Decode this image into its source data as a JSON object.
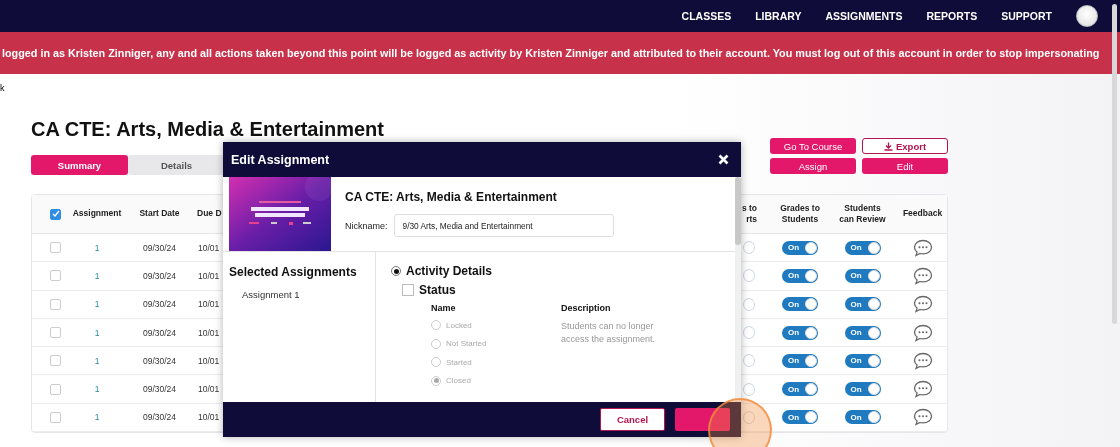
{
  "nav": {
    "items": [
      {
        "label": "CLASSES"
      },
      {
        "label": "LIBRARY"
      },
      {
        "label": "ASSIGNMENTS"
      },
      {
        "label": "REPORTS"
      },
      {
        "label": "SUPPORT"
      }
    ]
  },
  "banner": {
    "text": "logged in as Kristen Zinniger, any and all actions taken beyond this point will be logged as activity by Kristen Zinniger and attributed to their account. You must log out of this account in order to stop impersonating"
  },
  "stray_text": "k",
  "course": {
    "title": "CA CTE: Arts, Media & Entertainment"
  },
  "tabs": [
    {
      "label": "Summary",
      "selected": true
    },
    {
      "label": "Details",
      "selected": false
    }
  ],
  "actions": [
    {
      "label": "Go To Course",
      "kind": "filled"
    },
    {
      "label": "Export",
      "kind": "outline"
    },
    {
      "label": "Assign",
      "kind": "filled"
    },
    {
      "label": "Edit",
      "kind": "filled"
    }
  ],
  "table": {
    "select_all_checked": true,
    "columns": [
      "Assignment",
      "Start Date",
      "Due D",
      "s to\nrts",
      "Grades to\nStudents",
      "Students\ncan Review",
      "Feedback"
    ],
    "rows": [
      {
        "checked": false,
        "assignment": "1",
        "start_date": "09/30/24",
        "due_date": "10/01",
        "grades_to_students": {
          "on": true,
          "label": "On"
        },
        "students_can_review": {
          "on": true,
          "label": "On"
        }
      },
      {
        "checked": false,
        "assignment": "1",
        "start_date": "09/30/24",
        "due_date": "10/01",
        "grades_to_students": {
          "on": true,
          "label": "On"
        },
        "students_can_review": {
          "on": true,
          "label": "On"
        }
      },
      {
        "checked": false,
        "assignment": "1",
        "start_date": "09/30/24",
        "due_date": "10/01",
        "grades_to_students": {
          "on": true,
          "label": "On"
        },
        "students_can_review": {
          "on": true,
          "label": "On"
        }
      },
      {
        "checked": false,
        "assignment": "1",
        "start_date": "09/30/24",
        "due_date": "10/01",
        "grades_to_students": {
          "on": true,
          "label": "On"
        },
        "students_can_review": {
          "on": true,
          "label": "On"
        }
      },
      {
        "checked": false,
        "assignment": "1",
        "start_date": "09/30/24",
        "due_date": "10/01",
        "grades_to_students": {
          "on": true,
          "label": "On"
        },
        "students_can_review": {
          "on": true,
          "label": "On"
        }
      },
      {
        "checked": false,
        "assignment": "1",
        "start_date": "09/30/24",
        "due_date": "10/01",
        "grades_to_students": {
          "on": true,
          "label": "On"
        },
        "students_can_review": {
          "on": true,
          "label": "On"
        }
      },
      {
        "checked": false,
        "assignment": "1",
        "start_date": "09/30/24",
        "due_date": "10/01",
        "grades_to_students": {
          "on": true,
          "label": "On"
        },
        "students_can_review": {
          "on": true,
          "label": "On"
        }
      }
    ]
  },
  "dialog": {
    "title": "Edit Assignment",
    "course_title": "CA CTE: Arts, Media & Entertainment",
    "nickname_label": "Nickname:",
    "nickname_value": "9/30 Arts, Media and Entertainment",
    "selected_heading": "Selected Assignments",
    "selected_items": [
      "Assignment 1"
    ],
    "section": {
      "label": "Activity Details",
      "selected": true
    },
    "status": {
      "label": "Status",
      "checked": false
    },
    "status_columns": [
      "Name",
      "Description"
    ],
    "statuses": [
      {
        "label": "Locked",
        "selected": false,
        "disabled": true
      },
      {
        "label": "Not Started",
        "selected": false,
        "disabled": true
      },
      {
        "label": "Started",
        "selected": false,
        "disabled": true
      },
      {
        "label": "Closed",
        "selected": true,
        "disabled": true
      }
    ],
    "description": "Students can no longer access the assignment.",
    "cancel": "Cancel"
  }
}
